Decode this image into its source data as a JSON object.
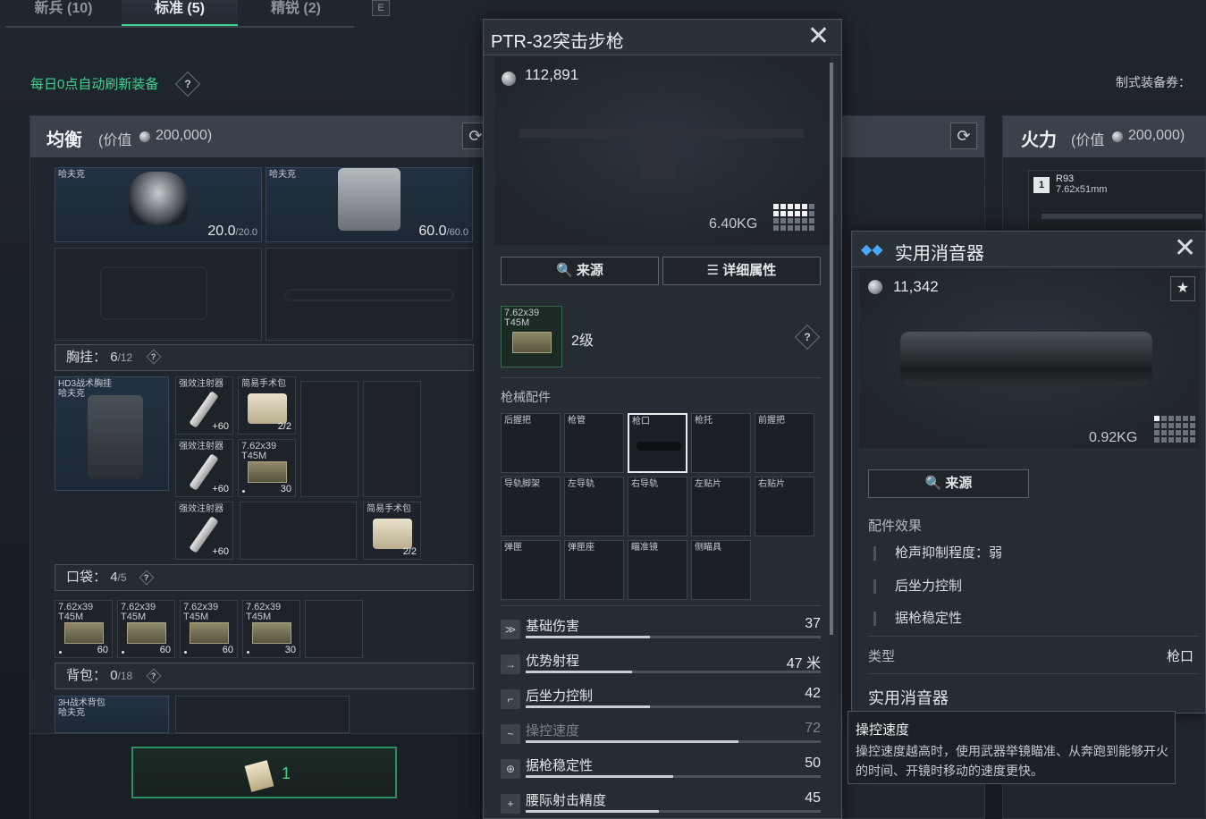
{
  "tabs": [
    {
      "label": "新兵 (10)"
    },
    {
      "label": "标准 (5)"
    },
    {
      "label": "精锐 (2)"
    }
  ],
  "tab_key": "E",
  "refresh_note": "每日0点自动刷新装备",
  "help_mark": "?",
  "voucher_label": "制式装备券：",
  "left_panel": {
    "title": "均衡",
    "value_prefix": "(价值",
    "value": "200,000)",
    "helmet": {
      "label": "哈夫克",
      "dur": "20.0",
      "dur_max": "/20.0"
    },
    "armor": {
      "label": "哈夫克",
      "dur": "60.0",
      "dur_max": "/60.0"
    },
    "chest": {
      "label": "胸挂：",
      "used": "6",
      "cap": "/12"
    },
    "chest_item": "HD3战术胸挂\n哈夫克",
    "syringe": "强效注射器",
    "syringe_qty": "+60",
    "pouch": "简易手术包",
    "pouch_qty": "2/2",
    "ammo": "7.62x39\nT45M",
    "ammo_qty30": "30",
    "ammo_qty60": "60",
    "pocket": {
      "label": "口袋：",
      "used": "4",
      "cap": "/5"
    },
    "backpack": {
      "label": "背包：",
      "used": "0",
      "cap": "/18"
    },
    "backpack_item": "3H战术背包\n哈夫克",
    "claim_count": "1"
  },
  "right_panel": {
    "title": "火力",
    "value_prefix": "(价值",
    "value": "200,000)",
    "item_index": "1",
    "item_name": "R93",
    "item_caliber": "7.62x51mm"
  },
  "weapon_popup": {
    "title": "PTR-32突击步枪",
    "price": "112,891",
    "weight": "6.40KG",
    "source_btn": "来源",
    "details_btn": "详细属性",
    "ammo_label": "7.62x39\nT45M",
    "ammo_level": "2级",
    "attachments_header": "枪械配件",
    "attachments": [
      "后握把",
      "枪管",
      "枪口",
      "枪托",
      "前握把",
      "导轨脚架",
      "左导轨",
      "右导轨",
      "左贴片",
      "右贴片",
      "弹匣",
      "弹匣座",
      "瞄准镜",
      "侧瞄具"
    ],
    "stats": [
      {
        "name": "基础伤害",
        "value": "37",
        "level": 0.42
      },
      {
        "name": "优势射程",
        "value": "47 米",
        "level": 0.36
      },
      {
        "name": "后坐力控制",
        "value": "42",
        "level": 0.42
      },
      {
        "name": "操控速度",
        "value": "72",
        "level": 0.72
      },
      {
        "name": "据枪稳定性",
        "value": "50",
        "level": 0.5
      },
      {
        "name": "腰际射击精度",
        "value": "45",
        "level": 0.45
      }
    ]
  },
  "suppressor_popup": {
    "title": "实用消音器",
    "price": "11,342",
    "weight": "0.92KG",
    "source_btn": "来源",
    "effects_header": "配件效果",
    "effects": [
      "枪声抑制程度：弱",
      "后坐力控制",
      "据枪稳定性"
    ],
    "type_label": "类型",
    "type_value": "枪口",
    "name": "实用消音器"
  },
  "tooltip": {
    "title": "操控速度",
    "body": "操控速度越高时，使用武器举镜瞄准、从奔跑到能够开火的时间、开镜时移动的速度更快。"
  },
  "colors": {
    "accent": "#3fd28f",
    "panel_header": "#3a414a"
  }
}
